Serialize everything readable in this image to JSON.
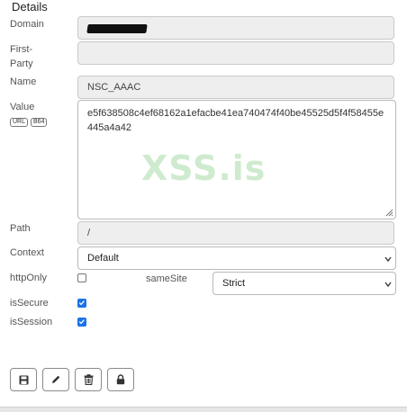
{
  "section": {
    "title": "Details"
  },
  "fields": {
    "domain": {
      "label": "Domain",
      "value": ""
    },
    "first_party": {
      "label": "First-\nParty",
      "value": ""
    },
    "name": {
      "label": "Name",
      "value": "NSC_AAAC"
    },
    "value": {
      "label": "Value",
      "badges": [
        "URL",
        "B64"
      ],
      "text": "e5f638508c4ef68162a1efacbe41ea740474f40be45525d5f4f58455e445a4a42"
    },
    "path": {
      "label": "Path",
      "value": "/"
    },
    "context": {
      "label": "Context",
      "selected": "Default"
    },
    "http_only": {
      "label": "httpOnly",
      "checked": false
    },
    "same_site": {
      "label": "sameSite",
      "selected": "Strict"
    },
    "is_secure": {
      "label": "isSecure",
      "checked": true
    },
    "is_session": {
      "label": "isSession",
      "checked": true
    }
  },
  "watermark": "XSS.is",
  "toolbar": {
    "icons": [
      "save-icon",
      "edit-icon",
      "trash-icon",
      "lock-icon"
    ]
  },
  "colors": {
    "accent": "#1a73e8",
    "readonly_bg": "#eeeeee"
  }
}
